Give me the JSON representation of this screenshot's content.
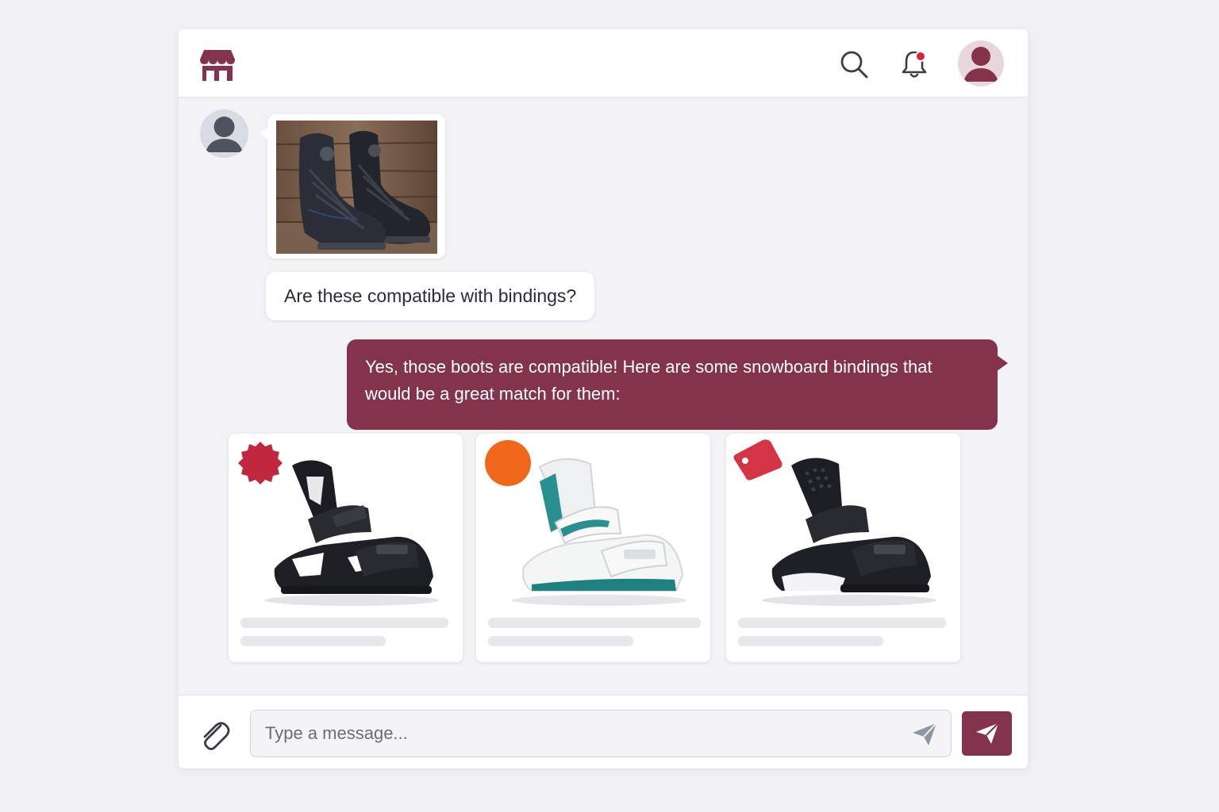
{
  "header": {
    "logo_icon": "storefront-icon",
    "search_icon": "search-icon",
    "notification_icon": "bell-icon",
    "notification_dot_color": "#d0263e",
    "avatar_icon": "user-avatar-icon"
  },
  "conversation": {
    "user_message_image": "snowboard-boots-photo",
    "user_message_text": "Are these compatible with bindings?",
    "bot_message_text": "Yes, those boots are compatible! Here are some snowboard bindings that would be a great match for them:"
  },
  "products": [
    {
      "image": "black-snowboard-binding",
      "badge_icon": "seal-badge-icon",
      "badge_color": "#c0283f"
    },
    {
      "image": "white-teal-snowboard-binding",
      "badge_icon": "circle-badge-icon",
      "badge_color": "#f0661a"
    },
    {
      "image": "black-white-snowboard-binding",
      "badge_icon": "price-tag-icon",
      "badge_color": "#d33446"
    }
  ],
  "composer": {
    "placeholder": "Type a message...",
    "attach_icon": "paperclip-icon",
    "send_icon": "send-icon"
  },
  "colors": {
    "brand": "#84334d",
    "background": "#f1f1f5"
  }
}
